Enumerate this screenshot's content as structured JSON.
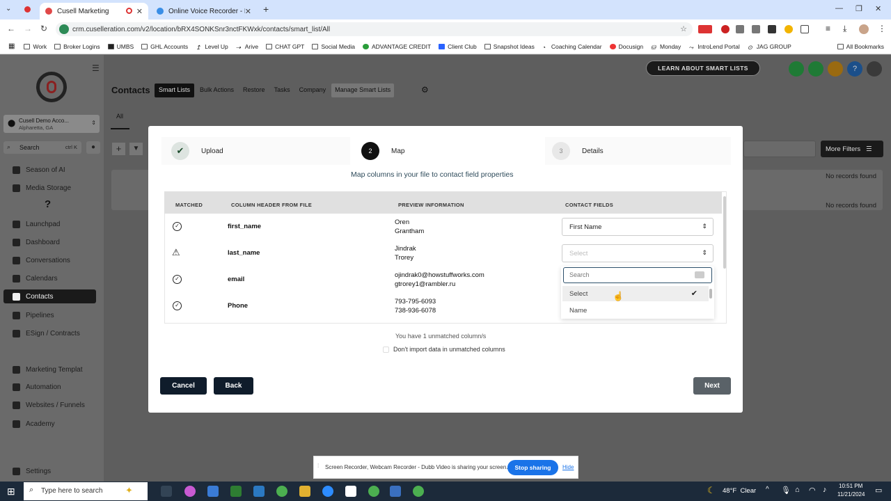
{
  "browser": {
    "tabs": [
      {
        "label": "Cusell Marketing",
        "active": true
      },
      {
        "label": "Online Voice Recorder - Record",
        "active": false
      }
    ],
    "url": "crm.cuselleration.com/v2/location/bRX4SONKSnr3nctFKWxk/contacts/smart_list/All",
    "bookmarks": [
      "Work",
      "Broker Logins",
      "UMBS",
      "GHL Accounts",
      "Level Up",
      "Arive",
      "CHAT GPT",
      "Social Media",
      "ADVANTAGE CREDIT",
      "Client Club",
      "Snapshot Ideas",
      "Coaching Calendar",
      "Docusign",
      "Monday",
      "IntroLend Portal",
      "JAG GROUP"
    ],
    "all_bookmarks": "All Bookmarks"
  },
  "topbar": {
    "learn_button": "LEARN ABOUT SMART LISTS"
  },
  "sidebar": {
    "account_name": "Cusell Demo Acco...",
    "account_location": "Alpharetta, GA",
    "search_placeholder": "Search",
    "search_shortcut": "ctrl K",
    "help": "?",
    "items": [
      {
        "label": "Season of AI"
      },
      {
        "label": "Media Storage"
      },
      {
        "label": "Launchpad"
      },
      {
        "label": "Dashboard"
      },
      {
        "label": "Conversations"
      },
      {
        "label": "Calendars"
      },
      {
        "label": "Contacts",
        "active": true
      },
      {
        "label": "Pipelines"
      },
      {
        "label": "ESign / Contracts"
      },
      {
        "label": "Marketing Templat"
      },
      {
        "label": "Automation"
      },
      {
        "label": "Websites / Funnels"
      },
      {
        "label": "Academy"
      },
      {
        "label": "Settings"
      }
    ]
  },
  "header": {
    "title": "Contacts",
    "tabs": [
      "Smart Lists",
      "Bulk Actions",
      "Restore",
      "Tasks",
      "Company",
      "Manage Smart Lists"
    ],
    "subtab": "All",
    "more_filters": "More Filters",
    "no_records": "No records found"
  },
  "modal": {
    "steps": [
      {
        "num": "",
        "label": "Upload",
        "state": "done"
      },
      {
        "num": "2",
        "label": "Map",
        "state": "active"
      },
      {
        "num": "3",
        "label": "Details",
        "state": "pending"
      }
    ],
    "subtitle": "Map columns in your file to contact field properties",
    "columns": [
      "MATCHED",
      "COLUMN HEADER FROM FILE",
      "PREVIEW INFORMATION",
      "CONTACT FIELDS"
    ],
    "rows": [
      {
        "header": "first_name",
        "preview1": "Oren",
        "preview2": "Grantham",
        "field": "First Name",
        "matched": true
      },
      {
        "header": "last_name",
        "preview1": "Jindrak",
        "preview2": "Trorey",
        "field": "Select",
        "matched": false
      },
      {
        "header": "email",
        "preview1": "ojindrak0@howstuffworks.com",
        "preview2": "gtrorey1@rambler.ru",
        "field": "",
        "matched": true
      },
      {
        "header": "Phone",
        "preview1": "793-795-6093",
        "preview2": "738-936-6078",
        "field": "",
        "matched": true
      }
    ],
    "dropdown": {
      "search_placeholder": "Search",
      "options": [
        "Select",
        "Name"
      ]
    },
    "unmatched_text": "You have 1 unmatched column/s",
    "checkbox_label": "Don't import data in unmatched columns",
    "cancel": "Cancel",
    "back": "Back",
    "next": "Next"
  },
  "share_bar": {
    "text": "Screen Recorder, Webcam Recorder - Dubb Video is sharing your screen.",
    "stop": "Stop sharing",
    "hide": "Hide"
  },
  "taskbar": {
    "search_placeholder": "Type here to search",
    "weather": "48°F  Clear",
    "time": "10:51 PM",
    "date": "11/21/2024"
  }
}
